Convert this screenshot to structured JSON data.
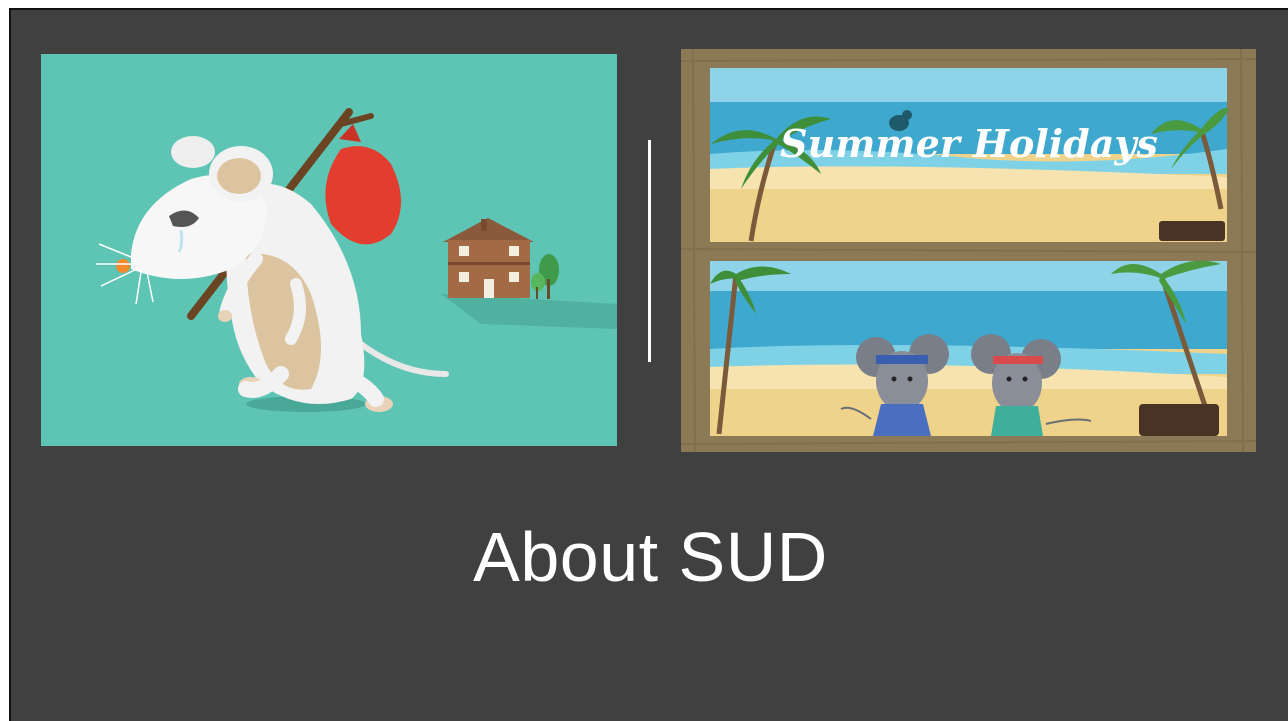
{
  "slide": {
    "title": "About SUD",
    "background_color": "#404040",
    "title_color": "#ffffff"
  },
  "left_image": {
    "description_icon": "mouse-leaving-home-illustration",
    "background_color": "#5ec5b4"
  },
  "right_image": {
    "banner_text": "Summer Holidays",
    "description_icon": "mice-summer-holiday-illustration",
    "frame_color": "#8b7a55"
  }
}
